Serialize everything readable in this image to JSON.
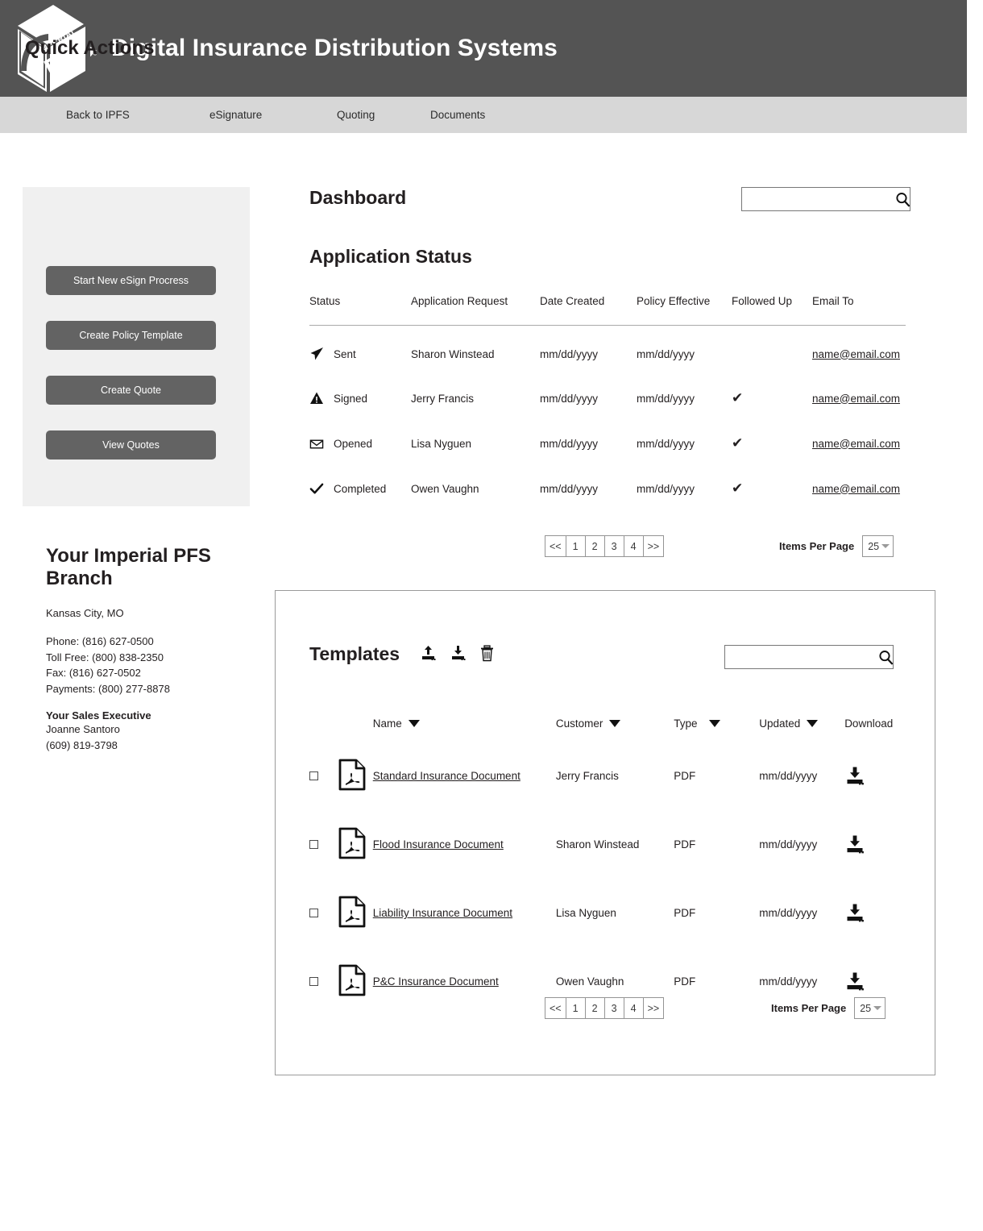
{
  "header": {
    "logo_alt": "Imperial PFS logo",
    "logo_text_top": "IMPERIAL",
    "logo_text_main": "PFS",
    "logo_mark": "®",
    "title": "Digital Insurance Distribution Systems",
    "bg_color": "#545454"
  },
  "nav": {
    "bg_color": "#d7d7d7",
    "items": [
      {
        "label": "Back to IPFS"
      },
      {
        "label": "eSignature"
      },
      {
        "label": "Quoting"
      },
      {
        "label": "Documents"
      }
    ]
  },
  "quick_actions": {
    "title": "Quick Actions",
    "bg_color": "#f0f0f0",
    "button_color": "#636363",
    "buttons": [
      {
        "label": "Start New eSign Procress"
      },
      {
        "label": "Create Policy Template"
      },
      {
        "label": "Create Quote"
      },
      {
        "label": "View Quotes"
      }
    ]
  },
  "branch": {
    "title": "Your Imperial PFS Branch",
    "location": "Kansas City, MO",
    "phone": "Phone: (816) 627-0500",
    "toll_free": "Toll Free: (800) 838-2350",
    "fax": "Fax: (816) 627-0502",
    "payments": "Payments: (800) 277-8878",
    "sales_exec_label": "Your Sales Executive",
    "sales_exec_name": "Joanne Santoro",
    "sales_exec_phone": "(609) 819-3798"
  },
  "dashboard": {
    "title": "Dashboard",
    "search_placeholder": "",
    "search_value": ""
  },
  "application_status": {
    "title": "Application Status",
    "columns": [
      "Status",
      "Application Request",
      "Date Created",
      "Policy Effective",
      "Followed Up",
      "Email To"
    ],
    "rows": [
      {
        "icon": "paper-plane-icon",
        "status": "Sent",
        "application_request": "Sharon Winstead",
        "date_created": "mm/dd/yyyy",
        "policy_effective": "mm/dd/yyyy",
        "followed_up": "",
        "email": "name@email.com"
      },
      {
        "icon": "warning-triangle-icon",
        "status": "Signed",
        "application_request": "Jerry Francis",
        "date_created": "mm/dd/yyyy",
        "policy_effective": "mm/dd/yyyy",
        "followed_up": "✔",
        "email": "name@email.com"
      },
      {
        "icon": "open-envelope-icon",
        "status": "Opened",
        "application_request": "Lisa Nyguen",
        "date_created": "mm/dd/yyyy",
        "policy_effective": "mm/dd/yyyy",
        "followed_up": "✔",
        "email": "name@email.com"
      },
      {
        "icon": "checkmark-icon",
        "status": "Completed",
        "application_request": "Owen Vaughn",
        "date_created": "mm/dd/yyyy",
        "policy_effective": "mm/dd/yyyy",
        "followed_up": "✔",
        "email": "name@email.com"
      }
    ],
    "pagination": {
      "first": "<<",
      "pages": [
        "1",
        "2",
        "3",
        "4"
      ],
      "last": ">>",
      "items_per_page_label": "Items Per Page",
      "items_per_page_value": "25"
    }
  },
  "templates": {
    "title": "Templates",
    "actions": [
      {
        "name": "upload-icon",
        "label": "Upload"
      },
      {
        "name": "download-icon",
        "label": "Download"
      },
      {
        "name": "trash-icon",
        "label": "Delete"
      }
    ],
    "search_placeholder": "",
    "search_value": "",
    "columns": [
      {
        "label": "Name",
        "sortable": true
      },
      {
        "label": "Customer",
        "sortable": true
      },
      {
        "label": "Type",
        "sortable": true
      },
      {
        "label": "Updated",
        "sortable": true
      },
      {
        "label": "Download",
        "sortable": false
      }
    ],
    "rows": [
      {
        "checked": false,
        "file_icon": "pdf-file-icon",
        "name": "Standard Insurance Document",
        "customer": "Jerry Francis",
        "type": "PDF",
        "updated": "mm/dd/yyyy"
      },
      {
        "checked": false,
        "file_icon": "pdf-file-icon",
        "name": "Flood Insurance Document",
        "customer": "Sharon Winstead",
        "type": "PDF",
        "updated": "mm/dd/yyyy"
      },
      {
        "checked": false,
        "file_icon": "pdf-file-icon",
        "name": "Liability Insurance Document",
        "customer": "Lisa Nyguen",
        "type": "PDF",
        "updated": "mm/dd/yyyy"
      },
      {
        "checked": false,
        "file_icon": "pdf-file-icon",
        "name": "P&C Insurance Document",
        "customer": "Owen Vaughn",
        "type": "PDF",
        "updated": "mm/dd/yyyy"
      }
    ],
    "pagination": {
      "first": "<<",
      "pages": [
        "1",
        "2",
        "3",
        "4"
      ],
      "last": ">>",
      "items_per_page_label": "Items Per Page",
      "items_per_page_value": "25"
    }
  }
}
